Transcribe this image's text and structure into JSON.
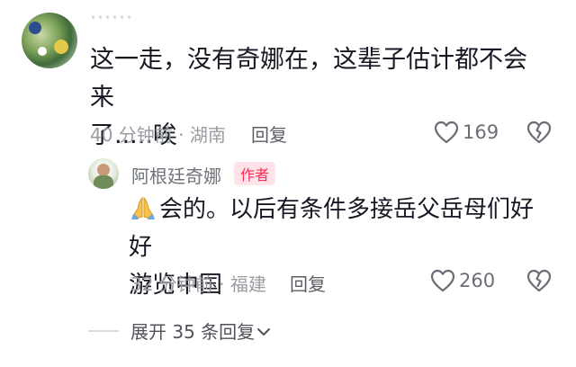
{
  "comment": {
    "author": "······",
    "text_line1": "这一走，没有奇娜在，这辈子估计都不会来",
    "text_line2": "了.....唉",
    "time": "40 分钟前 · 湖南",
    "reply_label": "回复",
    "likes": "169"
  },
  "reply": {
    "author": "阿根廷奇娜",
    "badge": "作者",
    "text_line1": "会的。以后有条件多接岳父岳母们好好",
    "text_line2": "游览中国",
    "time": "32 分钟前 · 福建",
    "reply_label": "回复",
    "likes": "260"
  },
  "expand": {
    "label": "展开 35 条回复"
  },
  "icons": {
    "like": "heart-outline-icon",
    "dislike": "broken-heart-icon",
    "emoji": "praying-hands-icon",
    "expand": "chevron-down-icon"
  }
}
